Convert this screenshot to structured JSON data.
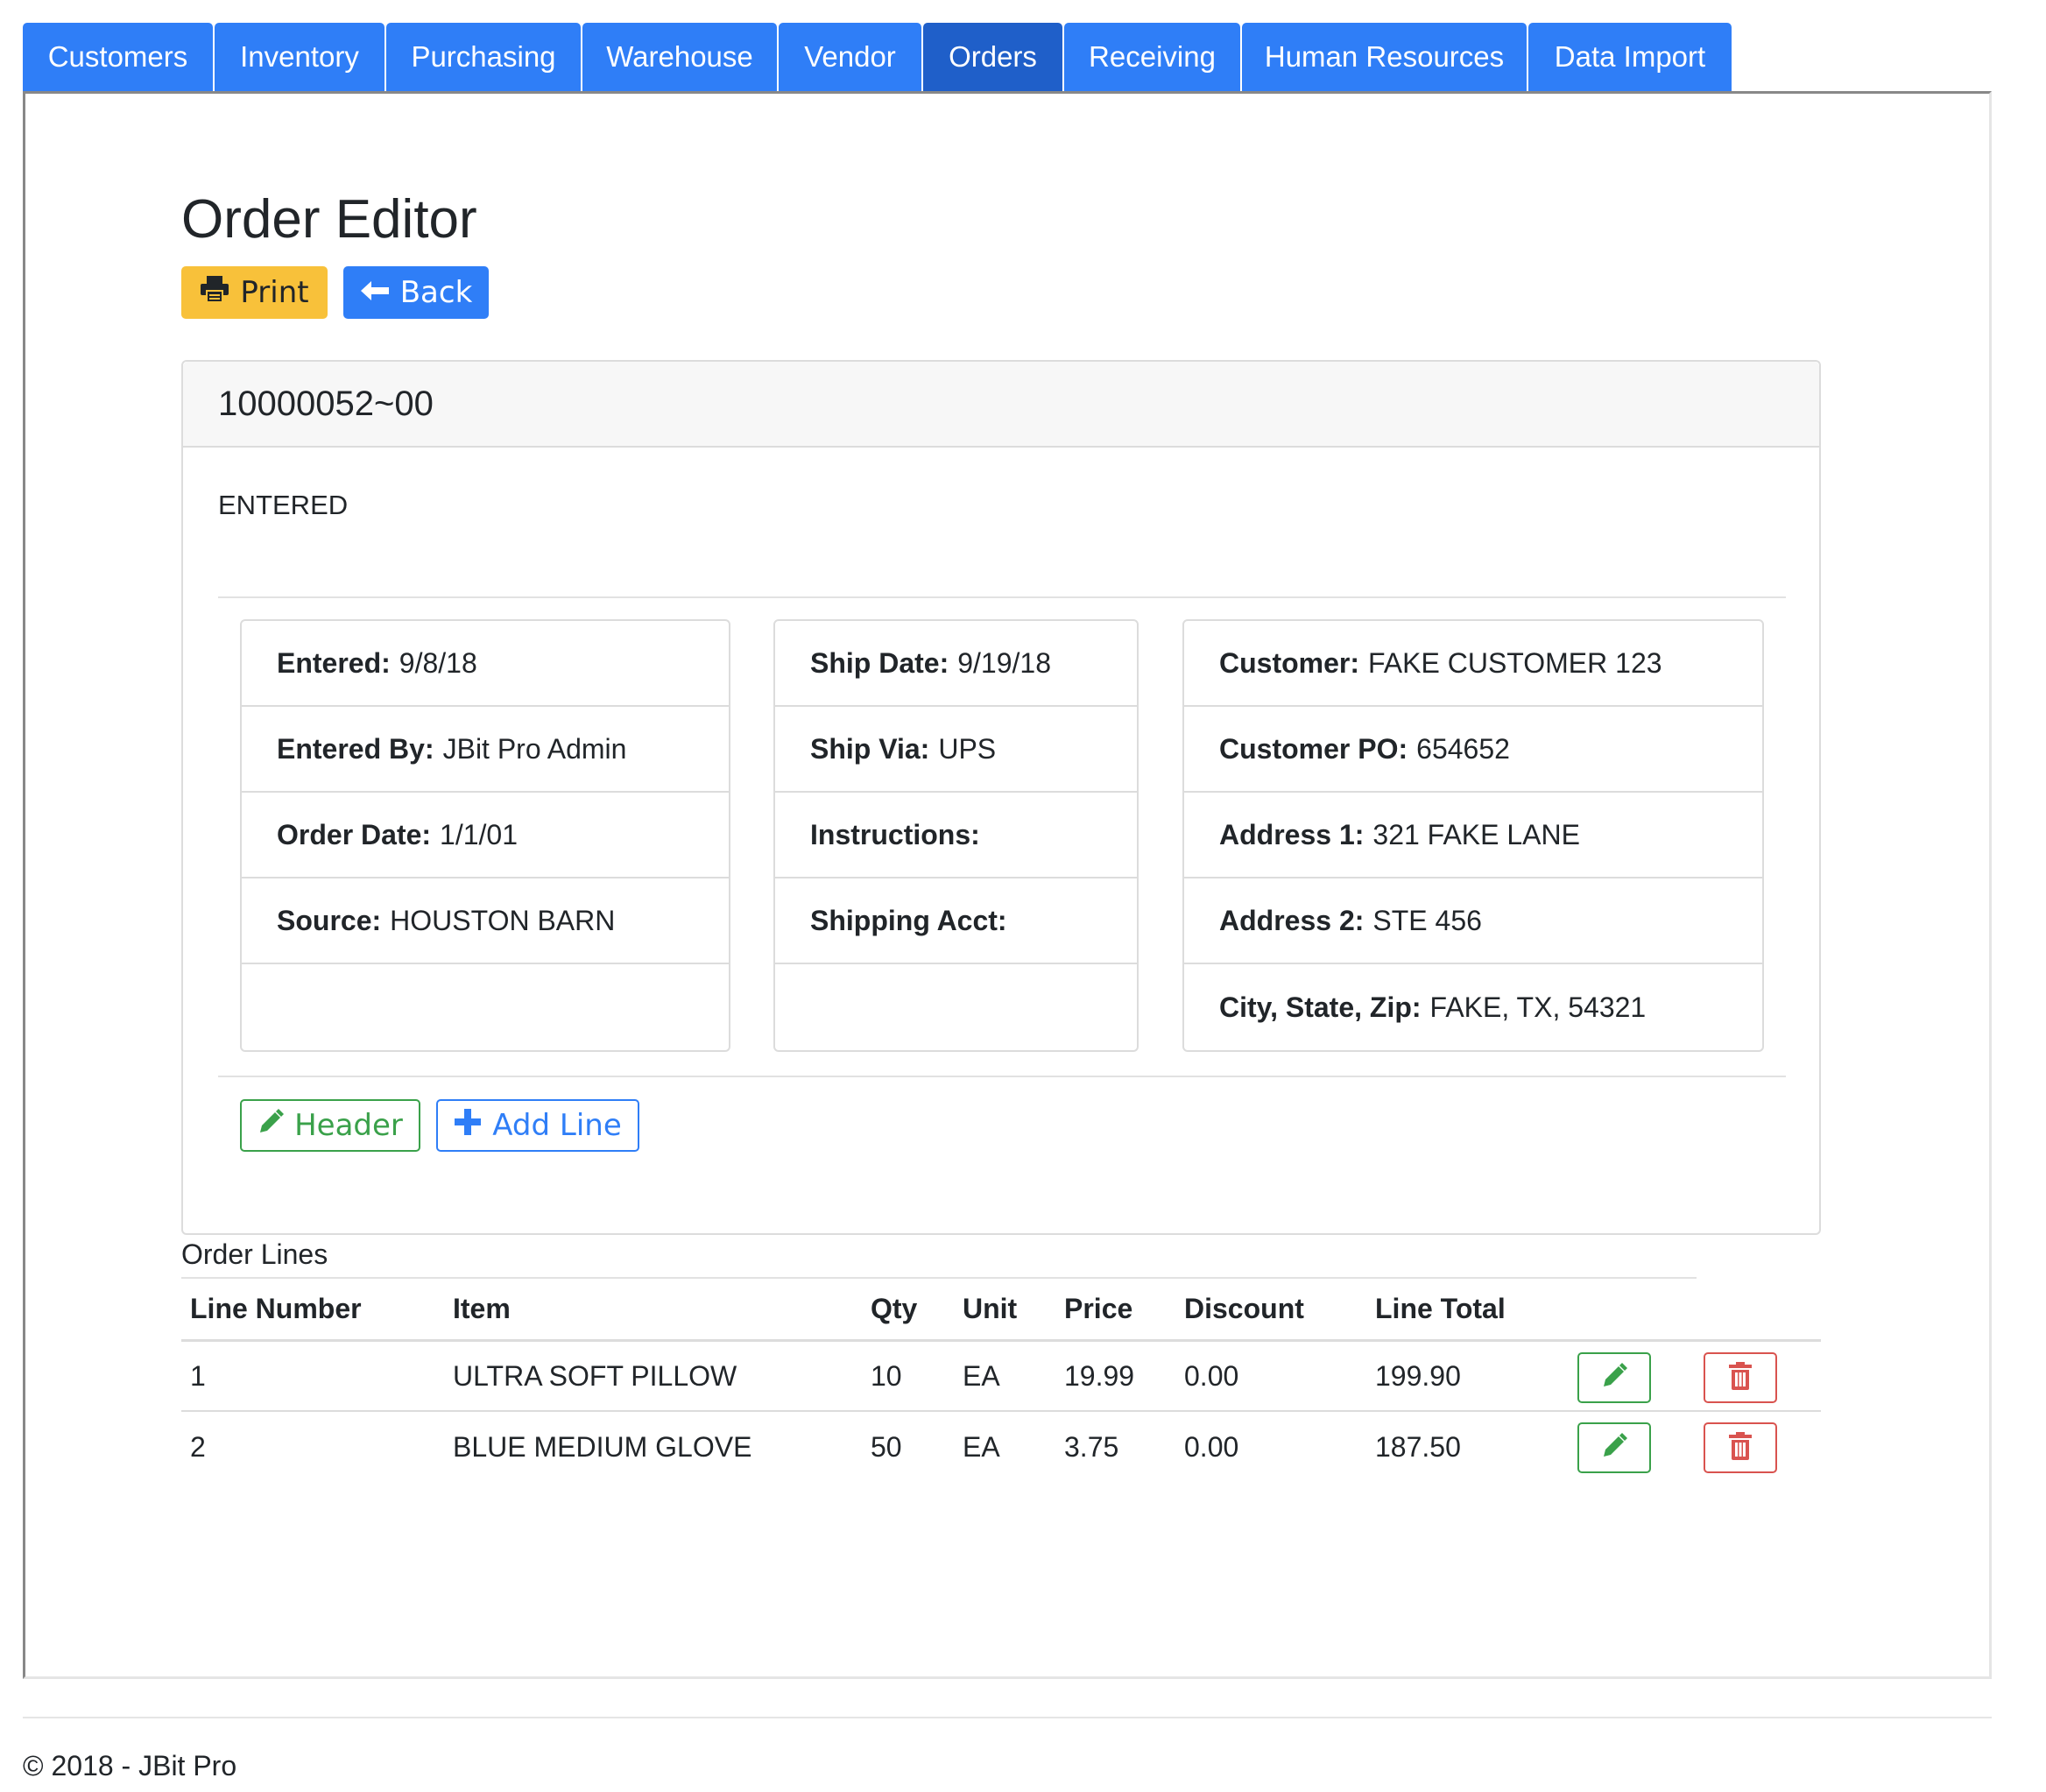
{
  "nav": {
    "tabs": [
      {
        "label": "Customers",
        "active": false
      },
      {
        "label": "Inventory",
        "active": false
      },
      {
        "label": "Purchasing",
        "active": false
      },
      {
        "label": "Warehouse",
        "active": false
      },
      {
        "label": "Vendor",
        "active": false
      },
      {
        "label": "Orders",
        "active": true
      },
      {
        "label": "Receiving",
        "active": false
      },
      {
        "label": "Human Resources",
        "active": false
      },
      {
        "label": "Data Import",
        "active": false
      }
    ]
  },
  "page": {
    "title": "Order Editor",
    "print_label": "Print",
    "back_label": "Back"
  },
  "order": {
    "number": "10000052~00",
    "status": "ENTERED",
    "left": [
      {
        "label": "Entered:",
        "value": "9/8/18"
      },
      {
        "label": "Entered By:",
        "value": "JBit Pro Admin"
      },
      {
        "label": "Order Date:",
        "value": "1/1/01"
      },
      {
        "label": "Source:",
        "value": "HOUSTON BARN"
      }
    ],
    "middle": [
      {
        "label": "Ship Date:",
        "value": "9/19/18"
      },
      {
        "label": "Ship Via:",
        "value": "UPS"
      },
      {
        "label": "Instructions:",
        "value": ""
      },
      {
        "label": "Shipping Acct:",
        "value": ""
      }
    ],
    "right": [
      {
        "label": "Customer:",
        "value": "FAKE CUSTOMER 123"
      },
      {
        "label": "Customer PO:",
        "value": "654652"
      },
      {
        "label": "Address 1:",
        "value": "321 FAKE LANE"
      },
      {
        "label": "Address 2:",
        "value": "STE 456"
      },
      {
        "label": "City, State, Zip:",
        "value": "FAKE, TX, 54321"
      }
    ],
    "header_button_label": "Header",
    "add_line_button_label": "Add Line"
  },
  "order_lines": {
    "caption": "Order Lines",
    "columns": [
      "Line Number",
      "Item",
      "Qty",
      "Unit",
      "Price",
      "Discount",
      "Line Total"
    ],
    "rows": [
      [
        "1",
        "ULTRA SOFT PILLOW",
        "10",
        "EA",
        "19.99",
        "0.00",
        "199.90"
      ],
      [
        "2",
        "BLUE MEDIUM GLOVE",
        "50",
        "EA",
        "3.75",
        "0.00",
        "187.50"
      ]
    ]
  },
  "footer": {
    "text": "© 2018 - JBit Pro"
  },
  "colors": {
    "primary": "#2f7ef7",
    "active_tab": "#1f5fc9",
    "warning": "#f8c13a",
    "success": "#3aa14a",
    "danger": "#d9534f"
  }
}
